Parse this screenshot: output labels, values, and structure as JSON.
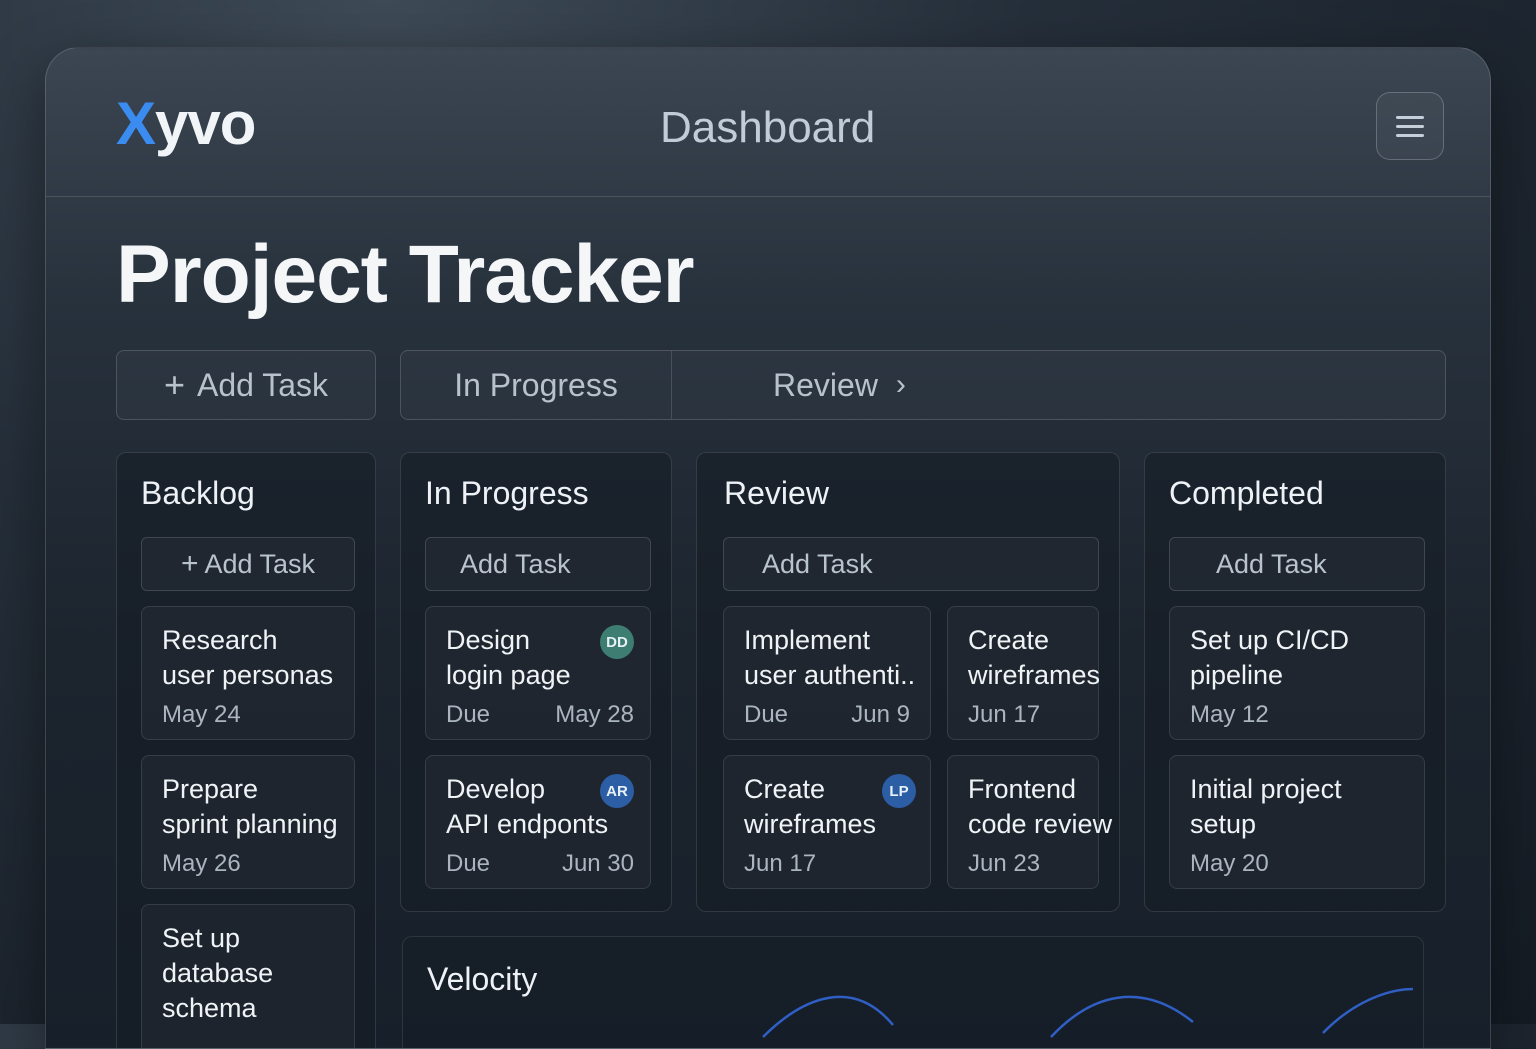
{
  "app": {
    "logo_x": "X",
    "logo_rest": "yvo",
    "header_title": "Dashboard",
    "menu_icon": "hamburger-menu-icon"
  },
  "page": {
    "title": "Project Tracker"
  },
  "toolbar": {
    "add_label": "Add Task",
    "filters": [
      "In Progress",
      "Review"
    ]
  },
  "board": {
    "backlog": {
      "title": "Backlog",
      "add_label": "Add Task",
      "cards": [
        {
          "title": "Research\nuser personas",
          "date": "May 24"
        },
        {
          "title": "Prepare\nsprint planning",
          "date": "May 26"
        },
        {
          "title": "Set up\ndatabase\nschema"
        }
      ]
    },
    "in_progress": {
      "title": "In Progress",
      "add_label": "Add Task",
      "cards": [
        {
          "title": "Design\nlogin page",
          "due_label": "Due",
          "date": "May 28",
          "avatar": "DD",
          "avatar_color": "#3d7d72"
        },
        {
          "title": "Develop\nAPI endponts",
          "due_label": "Due",
          "date": "Jun 30",
          "avatar": "AR",
          "avatar_color": "#2c5ea6"
        }
      ]
    },
    "review": {
      "title": "Review",
      "add_label": "Add Task",
      "cards": [
        {
          "title": "Implement\nuser authenti..",
          "due_label": "Due",
          "date": "Jun 9"
        },
        {
          "title": "Create\nwireframes",
          "date": "Jun 17"
        },
        {
          "title": "Create\nwireframes",
          "date": "Jun 17",
          "avatar": "LP",
          "avatar_color": "#2c5ea6"
        },
        {
          "title": "Frontend\ncode review",
          "date": "Jun 23"
        }
      ]
    },
    "completed": {
      "title": "Completed",
      "add_label": "Add Task",
      "cards": [
        {
          "title": "Set up CI/CD\npipeline",
          "date": "May 12"
        },
        {
          "title": "Initial project\nsetup",
          "date": "May 20"
        }
      ]
    }
  },
  "velocity": {
    "title": "Velocity",
    "line_color": "#2f5fc4"
  },
  "colors": {
    "accent": "#3b8cf0",
    "background": "#1c242e"
  }
}
